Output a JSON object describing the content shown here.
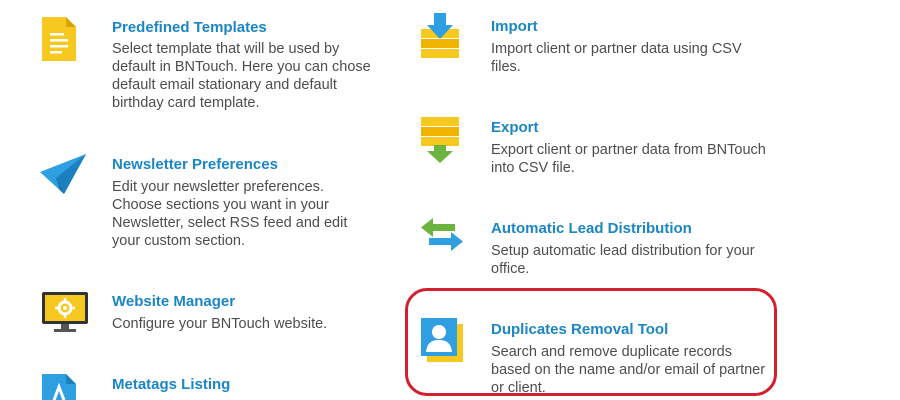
{
  "left_column": {
    "predefined_templates": {
      "icon": "document-icon",
      "title": "Predefined Templates",
      "desc": "Select template that will be used by default in BNTouch. Here you can chose default email stationary and default birthday card template."
    },
    "newsletter_preferences": {
      "icon": "paper-plane-icon",
      "title": "Newsletter Preferences",
      "desc": "Edit your newsletter preferences. Choose sections you want in your Newsletter, select RSS feed and edit your custom section."
    },
    "website_manager": {
      "icon": "monitor-gear-icon",
      "title": "Website Manager",
      "desc": "Configure your BNTouch website."
    },
    "metatags_listing": {
      "icon": "file-tag-icon",
      "title": "Metatags Listing"
    }
  },
  "right_column": {
    "import": {
      "icon": "import-icon",
      "title": "Import",
      "desc": "Import client or partner data using CSV files."
    },
    "export": {
      "icon": "export-icon",
      "title": "Export",
      "desc": "Export client or partner data from BNTouch into CSV file."
    },
    "lead_distribution": {
      "icon": "swap-arrows-icon",
      "title": "Automatic Lead Distribution",
      "desc": "Setup automatic lead distribution for your office."
    },
    "duplicates_removal": {
      "icon": "contact-card-icon",
      "title": "Duplicates Removal Tool",
      "desc": "Search and remove duplicate records based on the name and/or email of partner or client."
    }
  },
  "colors": {
    "title": "#1b86c4",
    "text": "#4d4d4d",
    "highlight": "#d2202f",
    "icon_yellow": "#f7c81f",
    "icon_blue": "#2e9fe0",
    "icon_green": "#6cb33f"
  }
}
